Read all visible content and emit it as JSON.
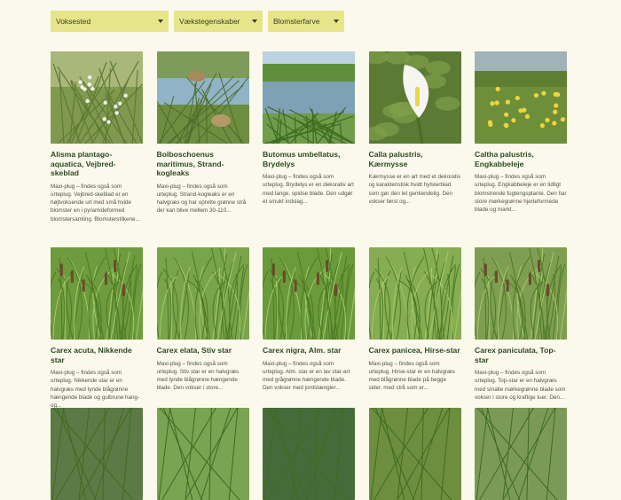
{
  "filters": [
    {
      "label": "Voksested"
    },
    {
      "label": "Vækstegenskaber"
    },
    {
      "label": "Blomsterfarve"
    }
  ],
  "plants": [
    {
      "title": "Alisma plantago-aquatica, Vejbred-skeblad",
      "desc": "Maxi-plug – findes også som urteplug. Vejbred-skeblad er en højtvoksende urt med små hvide blomster en i pyramideformed blomstersamling. Blomsterstilkene...",
      "image": "white-flowers"
    },
    {
      "title": "Bolboschoenus maritimus, Strand-kogleaks",
      "desc": "Maxi-plug – findes også som urteplug. Strand-kogleaks er en halvgræs og har oprette grønne strå der kan blive mellem 30-110...",
      "image": "sedge-water"
    },
    {
      "title": "Butomus umbellatus, Brydelys",
      "desc": "Maxi-plug – findes også som urteplug. Brydelys er en dekorativ art med lange, spidse blade. Den udgør et smukt indslag...",
      "image": "pond"
    },
    {
      "title": "Calla palustris, Kærmysse",
      "desc": "Kærmysse er en art med et dekorativ og karakteristisk hvidt hylsterblad som gør den let genkendelig.  Den vokser først og...",
      "image": "calla"
    },
    {
      "title": "Caltha palustris, Engkabbeleje",
      "desc": "Maxi-plug – findes også som urteplug. Engkabbeleje er en tidligt blomstrende fugtengsplante. Den har store mørkegrønne hjerteformede blade og markt...",
      "image": "yellow-flowers"
    },
    {
      "title": "Carex acuta, Nikkende star",
      "desc": "Maxi-plug – findes også som urteplug. Nikkende star er en halvgræs med tynde blågrønne hængende blade og gulbrune hang-og...",
      "image": "grass-1"
    },
    {
      "title": "Carex elata, Stiv star",
      "desc": "Maxi-plug – findes også som urteplug. Stiv star er en halvgræs med tynde blågrønne hængende blade. Den vokser i store...",
      "image": "grass-2"
    },
    {
      "title": "Carex nigra, Alm. star",
      "desc": "Maxi-plug – findes også som urteplug. Alm. star er en lav star-art med grågrønne hængende blade. Den vokser med jordstængler...",
      "image": "grass-3"
    },
    {
      "title": "Carex panicea, Hirse-star",
      "desc": "Maxi-plug – findes også som urteplug. Hirse-star er en halvgræs med blågrønne blade på begge sider, med strå som er...",
      "image": "grass-4"
    },
    {
      "title": "Carex paniculata, Top-star",
      "desc": "Maxi-plug – findes også som urteplug. Top-star er en halvgræs med smalle mørkegrønne blade som vokser i store og kraftige tuer. Den...",
      "image": "grass-5"
    },
    {
      "title": "",
      "desc": "",
      "image": "partial-1"
    },
    {
      "title": "",
      "desc": "",
      "image": "partial-2"
    },
    {
      "title": "",
      "desc": "",
      "image": "partial-3"
    },
    {
      "title": "",
      "desc": "",
      "image": "partial-4"
    },
    {
      "title": "",
      "desc": "",
      "image": "partial-5"
    }
  ]
}
